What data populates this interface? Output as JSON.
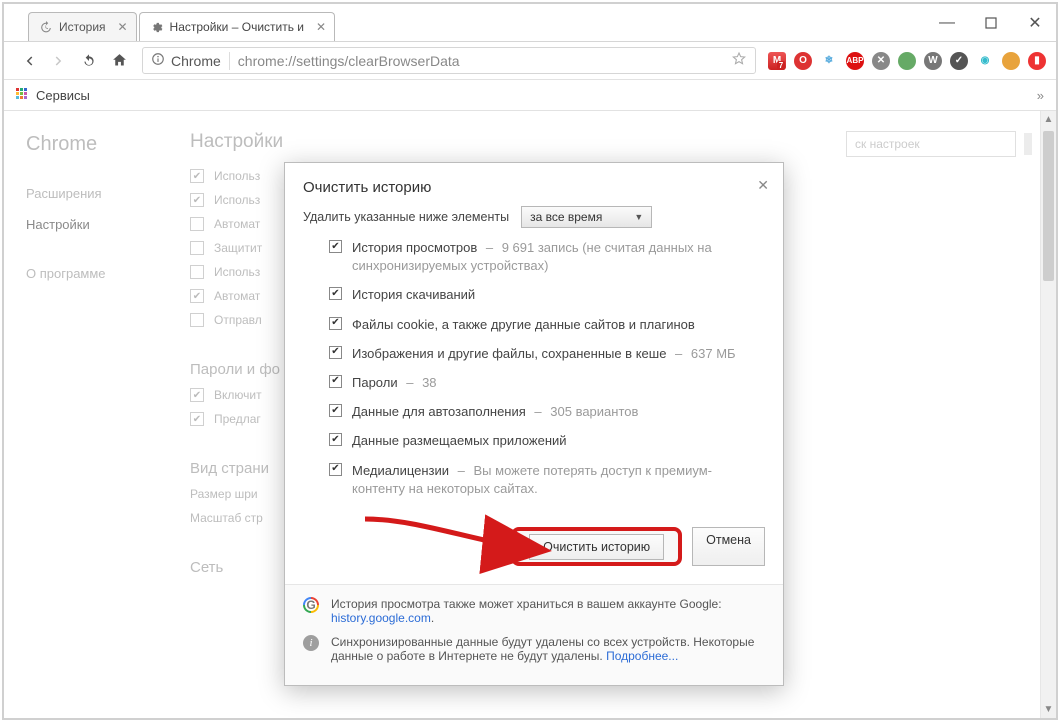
{
  "window": {
    "min": "—",
    "max": "▢",
    "close": "✕"
  },
  "tabs": [
    {
      "label": "История"
    },
    {
      "label": "Настройки – Очистить и"
    }
  ],
  "nav": {
    "origin_label": "Chrome",
    "url_path": "chrome://settings/clearBrowserData"
  },
  "bookmarks_bar": {
    "apps": "Сервисы",
    "overflow": "»"
  },
  "sidebar": {
    "brand": "Chrome",
    "items": [
      {
        "label": "Расширения"
      },
      {
        "label": "Настройки"
      },
      {
        "label": "О программе"
      }
    ]
  },
  "settings_page": {
    "title": "Настройки",
    "search_placeholder": "ск настроек",
    "group1": [
      {
        "checked": true,
        "label": "Использ"
      },
      {
        "checked": true,
        "label": "Использ"
      },
      {
        "checked": false,
        "label": "Автомат"
      },
      {
        "checked": false,
        "label": "Защитит"
      },
      {
        "checked": false,
        "label": "Использ"
      },
      {
        "checked": true,
        "label": "Автомат"
      },
      {
        "checked": false,
        "label": "Отправл"
      }
    ],
    "section_passwords": "Пароли и фо",
    "group2": [
      {
        "checked": true,
        "label": "Включит"
      },
      {
        "checked": true,
        "label": "Предлаг"
      }
    ],
    "section_view": "Вид страни",
    "view_rows": [
      {
        "label": "Размер шри"
      },
      {
        "label": "Масштаб стр"
      }
    ],
    "section_net": "Сеть"
  },
  "modal": {
    "title": "Очистить историю",
    "range_label": "Удалить указанные ниже элементы",
    "range_value": "за все время",
    "items": [
      {
        "checked": true,
        "label": "История просмотров",
        "detail": "9 691 запись (не считая данных на синхронизируемых устройствах)"
      },
      {
        "checked": true,
        "label": "История скачиваний",
        "detail": ""
      },
      {
        "checked": true,
        "label": "Файлы cookie, а также другие данные сайтов и плагинов",
        "detail": ""
      },
      {
        "checked": true,
        "label": "Изображения и другие файлы, сохраненные в кеше",
        "detail": "637 МБ"
      },
      {
        "checked": true,
        "label": "Пароли",
        "detail": "38"
      },
      {
        "checked": true,
        "label": "Данные для автозаполнения",
        "detail": "305 вариантов"
      },
      {
        "checked": true,
        "label": "Данные размещаемых приложений",
        "detail": ""
      },
      {
        "checked": true,
        "label": "Медиалицензии",
        "detail": "Вы можете потерять доступ к премиум-контенту на некоторых сайтах."
      }
    ],
    "btn_clear": "Очистить историю",
    "btn_cancel": "Отмена",
    "foot1_text": "История просмотра также может храниться в вашем аккаунте Google:",
    "foot1_link": "history.google.com",
    "foot2_text": "Синхронизированные данные будут удалены со всех устройств. Некоторые данные о работе в Интернете не будут удалены. ",
    "foot2_link": "Подробнее..."
  }
}
